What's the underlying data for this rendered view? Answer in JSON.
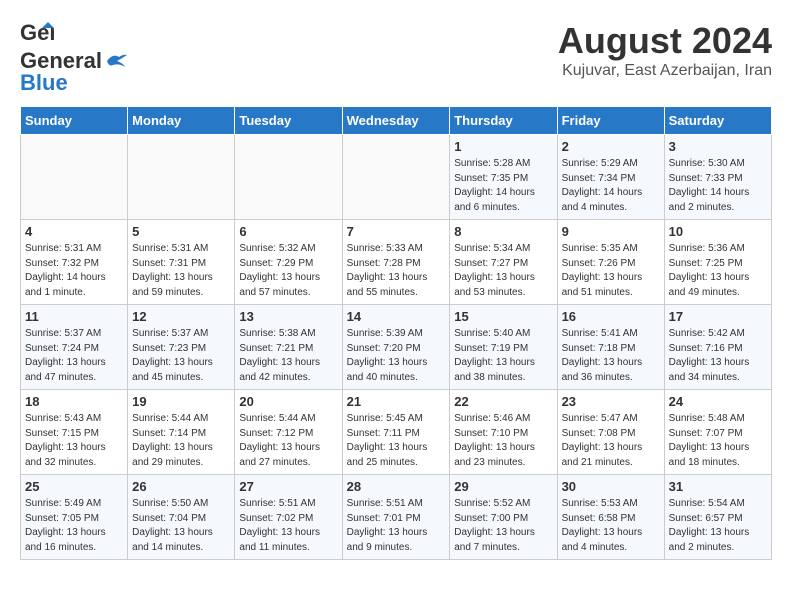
{
  "header": {
    "logo_line1": "General",
    "logo_line2": "Blue",
    "main_title": "August 2024",
    "subtitle": "Kujuvar, East Azerbaijan, Iran"
  },
  "calendar": {
    "days_of_week": [
      "Sunday",
      "Monday",
      "Tuesday",
      "Wednesday",
      "Thursday",
      "Friday",
      "Saturday"
    ],
    "weeks": [
      [
        {
          "day": "",
          "info": ""
        },
        {
          "day": "",
          "info": ""
        },
        {
          "day": "",
          "info": ""
        },
        {
          "day": "",
          "info": ""
        },
        {
          "day": "1",
          "info": "Sunrise: 5:28 AM\nSunset: 7:35 PM\nDaylight: 14 hours\nand 6 minutes."
        },
        {
          "day": "2",
          "info": "Sunrise: 5:29 AM\nSunset: 7:34 PM\nDaylight: 14 hours\nand 4 minutes."
        },
        {
          "day": "3",
          "info": "Sunrise: 5:30 AM\nSunset: 7:33 PM\nDaylight: 14 hours\nand 2 minutes."
        }
      ],
      [
        {
          "day": "4",
          "info": "Sunrise: 5:31 AM\nSunset: 7:32 PM\nDaylight: 14 hours\nand 1 minute."
        },
        {
          "day": "5",
          "info": "Sunrise: 5:31 AM\nSunset: 7:31 PM\nDaylight: 13 hours\nand 59 minutes."
        },
        {
          "day": "6",
          "info": "Sunrise: 5:32 AM\nSunset: 7:29 PM\nDaylight: 13 hours\nand 57 minutes."
        },
        {
          "day": "7",
          "info": "Sunrise: 5:33 AM\nSunset: 7:28 PM\nDaylight: 13 hours\nand 55 minutes."
        },
        {
          "day": "8",
          "info": "Sunrise: 5:34 AM\nSunset: 7:27 PM\nDaylight: 13 hours\nand 53 minutes."
        },
        {
          "day": "9",
          "info": "Sunrise: 5:35 AM\nSunset: 7:26 PM\nDaylight: 13 hours\nand 51 minutes."
        },
        {
          "day": "10",
          "info": "Sunrise: 5:36 AM\nSunset: 7:25 PM\nDaylight: 13 hours\nand 49 minutes."
        }
      ],
      [
        {
          "day": "11",
          "info": "Sunrise: 5:37 AM\nSunset: 7:24 PM\nDaylight: 13 hours\nand 47 minutes."
        },
        {
          "day": "12",
          "info": "Sunrise: 5:37 AM\nSunset: 7:23 PM\nDaylight: 13 hours\nand 45 minutes."
        },
        {
          "day": "13",
          "info": "Sunrise: 5:38 AM\nSunset: 7:21 PM\nDaylight: 13 hours\nand 42 minutes."
        },
        {
          "day": "14",
          "info": "Sunrise: 5:39 AM\nSunset: 7:20 PM\nDaylight: 13 hours\nand 40 minutes."
        },
        {
          "day": "15",
          "info": "Sunrise: 5:40 AM\nSunset: 7:19 PM\nDaylight: 13 hours\nand 38 minutes."
        },
        {
          "day": "16",
          "info": "Sunrise: 5:41 AM\nSunset: 7:18 PM\nDaylight: 13 hours\nand 36 minutes."
        },
        {
          "day": "17",
          "info": "Sunrise: 5:42 AM\nSunset: 7:16 PM\nDaylight: 13 hours\nand 34 minutes."
        }
      ],
      [
        {
          "day": "18",
          "info": "Sunrise: 5:43 AM\nSunset: 7:15 PM\nDaylight: 13 hours\nand 32 minutes."
        },
        {
          "day": "19",
          "info": "Sunrise: 5:44 AM\nSunset: 7:14 PM\nDaylight: 13 hours\nand 29 minutes."
        },
        {
          "day": "20",
          "info": "Sunrise: 5:44 AM\nSunset: 7:12 PM\nDaylight: 13 hours\nand 27 minutes."
        },
        {
          "day": "21",
          "info": "Sunrise: 5:45 AM\nSunset: 7:11 PM\nDaylight: 13 hours\nand 25 minutes."
        },
        {
          "day": "22",
          "info": "Sunrise: 5:46 AM\nSunset: 7:10 PM\nDaylight: 13 hours\nand 23 minutes."
        },
        {
          "day": "23",
          "info": "Sunrise: 5:47 AM\nSunset: 7:08 PM\nDaylight: 13 hours\nand 21 minutes."
        },
        {
          "day": "24",
          "info": "Sunrise: 5:48 AM\nSunset: 7:07 PM\nDaylight: 13 hours\nand 18 minutes."
        }
      ],
      [
        {
          "day": "25",
          "info": "Sunrise: 5:49 AM\nSunset: 7:05 PM\nDaylight: 13 hours\nand 16 minutes."
        },
        {
          "day": "26",
          "info": "Sunrise: 5:50 AM\nSunset: 7:04 PM\nDaylight: 13 hours\nand 14 minutes."
        },
        {
          "day": "27",
          "info": "Sunrise: 5:51 AM\nSunset: 7:02 PM\nDaylight: 13 hours\nand 11 minutes."
        },
        {
          "day": "28",
          "info": "Sunrise: 5:51 AM\nSunset: 7:01 PM\nDaylight: 13 hours\nand 9 minutes."
        },
        {
          "day": "29",
          "info": "Sunrise: 5:52 AM\nSunset: 7:00 PM\nDaylight: 13 hours\nand 7 minutes."
        },
        {
          "day": "30",
          "info": "Sunrise: 5:53 AM\nSunset: 6:58 PM\nDaylight: 13 hours\nand 4 minutes."
        },
        {
          "day": "31",
          "info": "Sunrise: 5:54 AM\nSunset: 6:57 PM\nDaylight: 13 hours\nand 2 minutes."
        }
      ]
    ]
  }
}
